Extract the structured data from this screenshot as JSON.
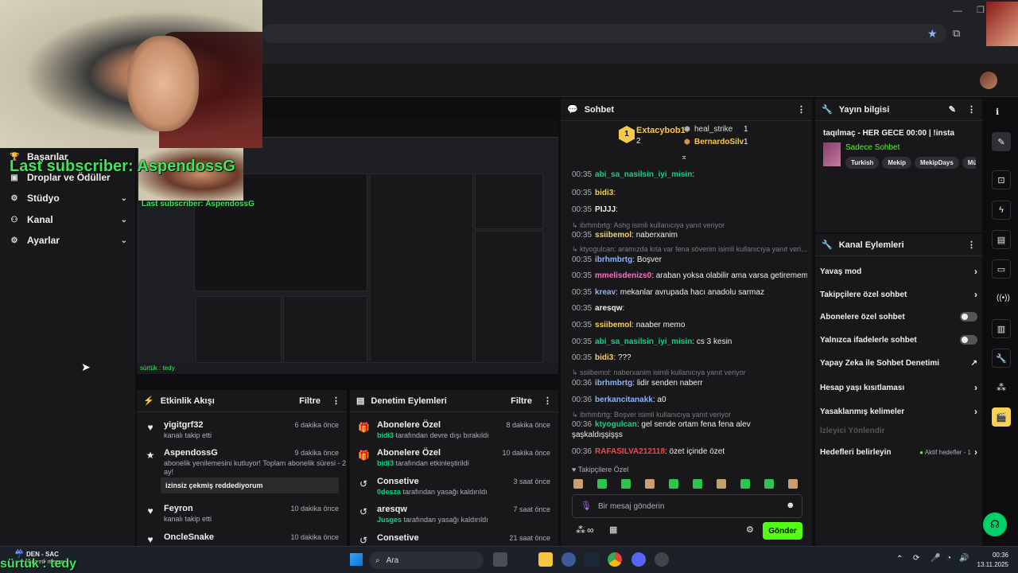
{
  "webcam": {
    "overlay_text": "Last subscriber: AspendossG",
    "caption_text": "sürtük : tedy"
  },
  "nav": {
    "items": [
      {
        "label": "Başarılar",
        "icon": "trophy-icon",
        "expandable": false
      },
      {
        "label": "Droplar ve Ödüller",
        "icon": "gift-icon",
        "expandable": false
      },
      {
        "label": "Stüdyo",
        "icon": "studio-icon",
        "expandable": true
      },
      {
        "label": "Kanal",
        "icon": "channel-icon",
        "expandable": true
      },
      {
        "label": "Ayarlar",
        "icon": "gear-icon",
        "expandable": true
      }
    ]
  },
  "preview": {
    "overlay_text": "Last subscriber: AspendossG",
    "caption": "sürtük : tedy"
  },
  "activity_feed": {
    "title": "Etkinlik Akışı",
    "filter_label": "Filtre",
    "events": [
      {
        "name": "yigitgrf32",
        "time": "6 dakika önce",
        "sub": "kanalı takip etti",
        "icon": "heart-icon"
      },
      {
        "name": "AspendossG",
        "time": "9 dakika önce",
        "sub": "abonelik yenilemesini kutluyor! Toplam abonelik süresi - 2 ay!",
        "icon": "star-icon",
        "message": "izinsiz çekmiş reddediyorum"
      },
      {
        "name": "Feyron",
        "time": "10 dakika önce",
        "sub": "kanalı takip etti",
        "icon": "heart-icon"
      },
      {
        "name": "OncleSnake",
        "time": "10 dakika önce",
        "sub": "",
        "icon": "heart-icon"
      }
    ]
  },
  "moderation": {
    "title": "Denetim Eylemleri",
    "filter_label": "Filtre",
    "events": [
      {
        "name": "Abonelere Özel",
        "time": "8 dakika önce",
        "user": "bidi3",
        "sub": " tarafından devre dışı bırakıldı",
        "icon": "gift-icon"
      },
      {
        "name": "Abonelere Özel",
        "time": "10 dakika önce",
        "user": "bidi3",
        "sub": " tarafından etkinleştirildi",
        "icon": "gift-icon"
      },
      {
        "name": "Consetive",
        "time": "3 saat önce",
        "user": "0desza",
        "sub": " tarafından yasağı kaldırıldı",
        "icon": "undo-icon"
      },
      {
        "name": "aresqw",
        "time": "7 saat önce",
        "user": "Jusges",
        "sub": " tarafından yasağı kaldırıldı",
        "icon": "undo-icon"
      },
      {
        "name": "Consetive",
        "time": "21 saat önce",
        "user": "",
        "sub": "",
        "icon": "undo-icon"
      }
    ]
  },
  "chat": {
    "title": "Sohbet",
    "leaderboard": [
      {
        "rank": "1",
        "name": "Extacybob1",
        "count": "2"
      },
      {
        "rank": "",
        "name": "heal_strike",
        "count": "1"
      },
      {
        "rank": "",
        "name": "BernardoSilv",
        "count": "1"
      }
    ],
    "lines": [
      {
        "time": "00:35",
        "user": "abi_sa_nasilsin_iyi_misin",
        "color": "#00db84",
        "text": ""
      },
      {
        "time": "00:35",
        "user": "bidi3",
        "color": "#f7d154",
        "text": ""
      },
      {
        "time": "00:35",
        "user": "PIJJJ",
        "color": "#efeff1",
        "text": ""
      },
      {
        "reply": "ibrhmbrtg: Ashg isimli kullanıcıya yanıt veriyor"
      },
      {
        "time": "00:35",
        "user": "ssiibemol",
        "color": "#f7d154",
        "text": "naberxanim"
      },
      {
        "reply": "ktyogulcan: aramızda kıta var fena söverim isimli kullanıcıya yanıt veri..."
      },
      {
        "time": "00:35",
        "user": "ibrhmbrtg",
        "color": "#8ab4f8",
        "text": "Boşver"
      },
      {
        "time": "00:35",
        "user": "mmelisdenizs0",
        "color": "#ff6ec7",
        "text": "araban yoksa olabilir ama varsa getiremem"
      },
      {
        "time": "00:35",
        "user": "kreav",
        "color": "#8ab4f8",
        "text": "mekanlar avrupada hacı anadolu sarmaz"
      },
      {
        "time": "00:35",
        "user": "aresqw",
        "color": "#efeff1",
        "text": ""
      },
      {
        "time": "00:35",
        "user": "ssiibemol",
        "color": "#f7d154",
        "text": "naaber memo"
      },
      {
        "time": "00:35",
        "user": "abi_sa_nasilsin_iyi_misin",
        "color": "#00db84",
        "text": "cs 3 kesin"
      },
      {
        "time": "00:35",
        "user": "bidi3",
        "color": "#f7d154",
        "text": "???"
      },
      {
        "reply": "ssiibemol: naberxanim isimli kullanıcıya yanıt veriyor"
      },
      {
        "time": "00:36",
        "user": "ibrhmbrtg",
        "color": "#8ab4f8",
        "text": "lidir senden naberr"
      },
      {
        "time": "00:36",
        "user": "berkancitanakk",
        "color": "#8ab4f8",
        "text": "a0"
      },
      {
        "reply": "ibrhmbrtg: Boşver isimli kullanıcıya yanıt veriyor"
      },
      {
        "time": "00:36",
        "user": "ktyogulcan",
        "color": "#00db84",
        "text": "gel sende ortam fena fena alev"
      },
      {
        "cont": "şaşkaldışşişşs"
      },
      {
        "time": "00:36",
        "user": "RAFASILVA212118",
        "color": "#ff4040",
        "text": "özet içinde özet"
      }
    ],
    "followers_only_label": "Takipçilere Özel",
    "input_placeholder": "Bir mesaj gönderin",
    "send_label": "Gönder",
    "points_label": "∞"
  },
  "stream_info": {
    "title": "Yayın bilgisi",
    "stream_title": "taqılmaç - HER GECE 00:00 | !insta",
    "category": "Sadece Sohbet",
    "tags": [
      "Turkish",
      "Mekip",
      "MekipDays",
      "Mü"
    ]
  },
  "channel_actions": {
    "title": "Kanal Eylemleri",
    "items": [
      {
        "label": "Yavaş mod",
        "control": "chevron"
      },
      {
        "label": "Takipçilere özel sohbet",
        "control": "chevron"
      },
      {
        "label": "Abonelere özel sohbet",
        "control": "toggle"
      },
      {
        "label": "Yalnızca ifadelerle sohbet",
        "control": "toggle"
      },
      {
        "label": "Yapay Zeka ile Sohbet Denetimi",
        "control": "external"
      },
      {
        "label": "Hesap yaşı kısıtlaması",
        "control": "chevron"
      },
      {
        "label": "Yasaklanmış kelimeler",
        "control": "chevron"
      },
      {
        "label": "İzleyici Yönlendir",
        "control": "none",
        "disabled": true
      },
      {
        "label": "Hedefleri belirleyin",
        "control": "chevron",
        "status": "Aktif hedefler - 1"
      }
    ]
  },
  "taskbar": {
    "search_placeholder": "Ara",
    "tray_app": "DEN - SAC",
    "tray_app_sub": "Kuvvetli rüzgar",
    "time": "00:36",
    "date": "13.11.2025"
  },
  "colors": {
    "accent": "#53fc18",
    "green": "#00db84",
    "bg": "#18181b"
  }
}
